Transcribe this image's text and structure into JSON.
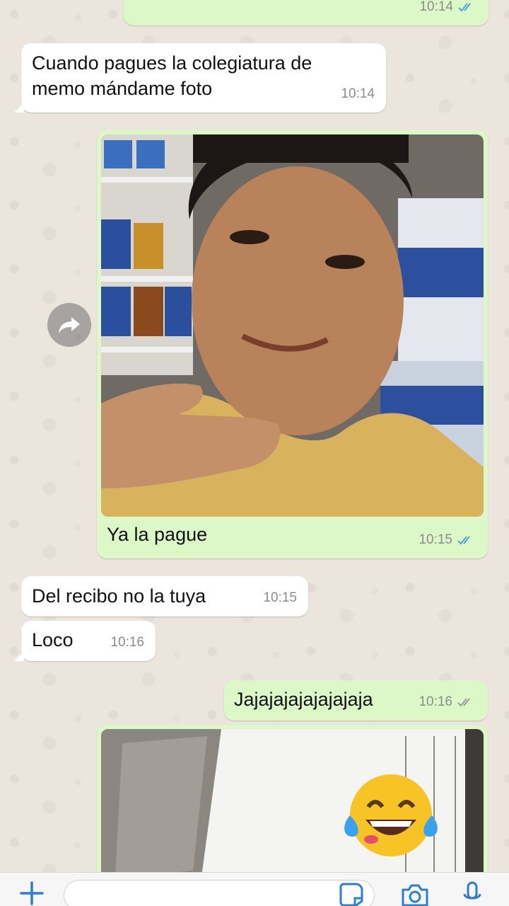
{
  "colors": {
    "outgoing_bubble": "#DCF8C6",
    "incoming_bubble": "#FFFFFF",
    "read_tick": "#4FA3E0",
    "sent_tick": "#9a9a9a",
    "chat_background": "#ECE5DD",
    "icon_blue": "#2A7FD4"
  },
  "messages": [
    {
      "direction": "outgoing",
      "text": "",
      "time": "10:14",
      "status": "read"
    },
    {
      "direction": "incoming",
      "text": "Cuando pagues la colegiatura de memo mándame foto",
      "time": "10:14"
    },
    {
      "direction": "outgoing",
      "image": "selfie-photo",
      "text": "Ya la pague",
      "time": "10:15",
      "status": "read"
    },
    {
      "direction": "incoming",
      "text": "Del recibo no la tuya",
      "time": "10:15"
    },
    {
      "direction": "incoming",
      "text": "Loco",
      "time": "10:16"
    },
    {
      "direction": "outgoing",
      "text": "Jajajajajajajajaja",
      "time": "10:16",
      "status": "delivered"
    },
    {
      "direction": "outgoing",
      "image": "receipt-photo",
      "sticker": "laughing-tears-emoji"
    }
  ],
  "input_bar": {
    "icons": [
      "plus-icon",
      "sticker-icon",
      "camera-icon",
      "microphone-icon"
    ]
  }
}
